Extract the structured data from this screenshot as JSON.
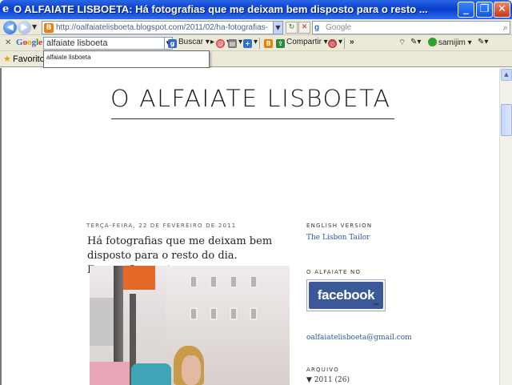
{
  "window": {
    "title": "O ALFAIATE LISBOETA: Há fotografias que me deixam bem disposto para o resto ...",
    "min_glyph": "_",
    "max_glyph": "❐",
    "close_glyph": "✕"
  },
  "addressbar": {
    "url": "http://oalfaiatelisboeta.blogspot.com/2011/02/ha-fotografias-",
    "search_placeholder": "Google"
  },
  "google_toolbar": {
    "logo": [
      "G",
      "o",
      "o",
      "g",
      "l",
      "e"
    ],
    "search_value": "alfaiate lisboeta",
    "buscar_label": "Buscar",
    "compartir_label": "Compartir",
    "more_label": "»",
    "user_label": "samijim"
  },
  "favorites": {
    "label": "Favorito"
  },
  "suggestion": {
    "item": "alfaiate lisboeta"
  },
  "blog": {
    "title": "O ALFAIATE LISBOETA"
  },
  "post": {
    "date": "TERÇA-FEIRA, 22 DE FEVEREIRO DE 2011",
    "title": "Há fotografias que me deixam bem disposto para o resto do dia. Fotografias assim"
  },
  "sidebar": {
    "english_heading": "ENGLISH VERSION",
    "english_link": "The Lisbon Tailor",
    "facebook_heading": "O ALFAIATE NO",
    "facebook_label": "facebook",
    "email": "oalfaiatelisboeta@gmail.com",
    "archive_heading": "ARQUIVO",
    "archive_year": "▼ 2011 (26)"
  },
  "colors": {
    "titlebar_blue": "#0a3fc9",
    "facebook_blue": "#3b5998",
    "link_blue": "#2a5a9a"
  }
}
